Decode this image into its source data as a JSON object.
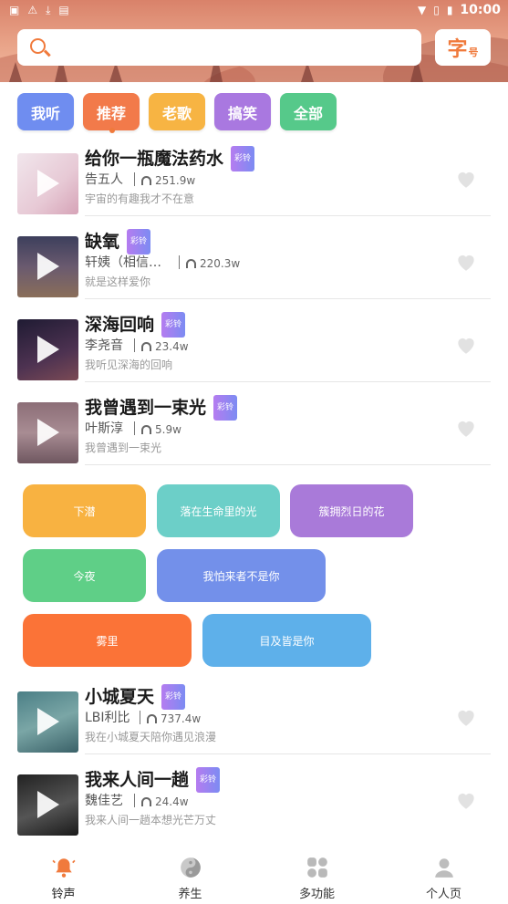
{
  "status_bar": {
    "time": "10:00"
  },
  "search": {
    "placeholder": ""
  },
  "font_button": {
    "main": "字",
    "sub": "号"
  },
  "categories": [
    {
      "label": "我听",
      "color": "#6f8df0"
    },
    {
      "label": "推荐",
      "color": "#f27a4a"
    },
    {
      "label": "老歌",
      "color": "#f7b443"
    },
    {
      "label": "搞笑",
      "color": "#a978e0"
    },
    {
      "label": "全部",
      "color": "#56c98a"
    }
  ],
  "badge_label": "彩铃",
  "songs": [
    {
      "title": "给你一瓶魔法药水",
      "artist": "告五人",
      "plays": "251.9w",
      "desc": "宇宙的有趣我才不在意"
    },
    {
      "title": "缺氧",
      "artist": "轩姨（相信…",
      "plays": "220.3w",
      "desc": "就是这样爱你"
    },
    {
      "title": "深海回响",
      "artist": "李尧音",
      "plays": "23.4w",
      "desc": "我听见深海的回响"
    },
    {
      "title": "我曾遇到一束光",
      "artist": "叶斯淳",
      "plays": "5.9w",
      "desc": "我曾遇到一束光"
    },
    {
      "title": "小城夏天",
      "artist": "LBI利比",
      "plays": "737.4w",
      "desc": "我在小城夏天陪你遇见浪漫"
    },
    {
      "title": "我来人间一趟",
      "artist": "魏佳艺",
      "plays": "24.4w",
      "desc": "我来人间一趟本想光芒万丈"
    }
  ],
  "tags": [
    {
      "label": "下潜",
      "color": "#f8b241"
    },
    {
      "label": "落在生命里的光",
      "color": "#6ccfc8"
    },
    {
      "label": "簇拥烈日的花",
      "color": "#a97ad9"
    },
    {
      "label": "今夜",
      "color": "#5fcf87"
    },
    {
      "label": "我怕来者不是你",
      "color": "#7390ea"
    },
    {
      "label": "雾里",
      "color": "#fb7337"
    },
    {
      "label": "目及皆是你",
      "color": "#5eb0ea"
    }
  ],
  "nav": [
    {
      "label": "铃声",
      "icon": "bell-icon",
      "active": true
    },
    {
      "label": "养生",
      "icon": "yin-yang-icon",
      "active": false
    },
    {
      "label": "多功能",
      "icon": "grid-icon",
      "active": false
    },
    {
      "label": "个人页",
      "icon": "user-icon",
      "active": false
    }
  ],
  "colors": {
    "accent": "#f07a3c",
    "heart": "#e2e2e2"
  }
}
